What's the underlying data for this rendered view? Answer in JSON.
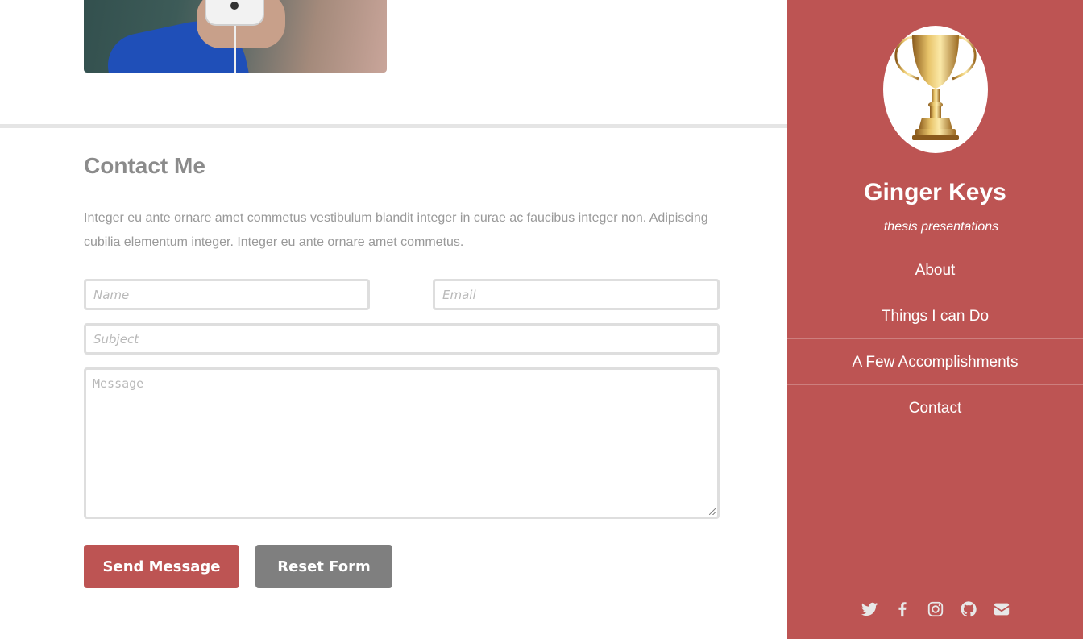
{
  "contact": {
    "title": "Contact Me",
    "intro": "Integer eu ante ornare amet commetus vestibulum blandit integer in curae ac faucibus integer non. Adipiscing cubilia elementum integer. Integer eu ante ornare amet commetus.",
    "name_placeholder": "Name",
    "email_placeholder": "Email",
    "subject_placeholder": "Subject",
    "message_placeholder": "Message",
    "send_label": "Send Message",
    "reset_label": "Reset Form"
  },
  "sidebar": {
    "name": "Ginger Keys",
    "tagline": "thesis presentations",
    "nav": [
      {
        "label": "About"
      },
      {
        "label": "Things I can Do"
      },
      {
        "label": "A Few Accomplishments"
      },
      {
        "label": "Contact"
      }
    ],
    "social_icons": [
      "twitter-icon",
      "facebook-icon",
      "instagram-icon",
      "github-icon",
      "envelope-icon"
    ]
  },
  "colors": {
    "accent": "#bd5453",
    "reset_button": "#7f7f7f",
    "heading": "#8b8b8b",
    "body_text": "#999999",
    "field_border": "#dedede",
    "social_icon": "#e8e8e8"
  }
}
